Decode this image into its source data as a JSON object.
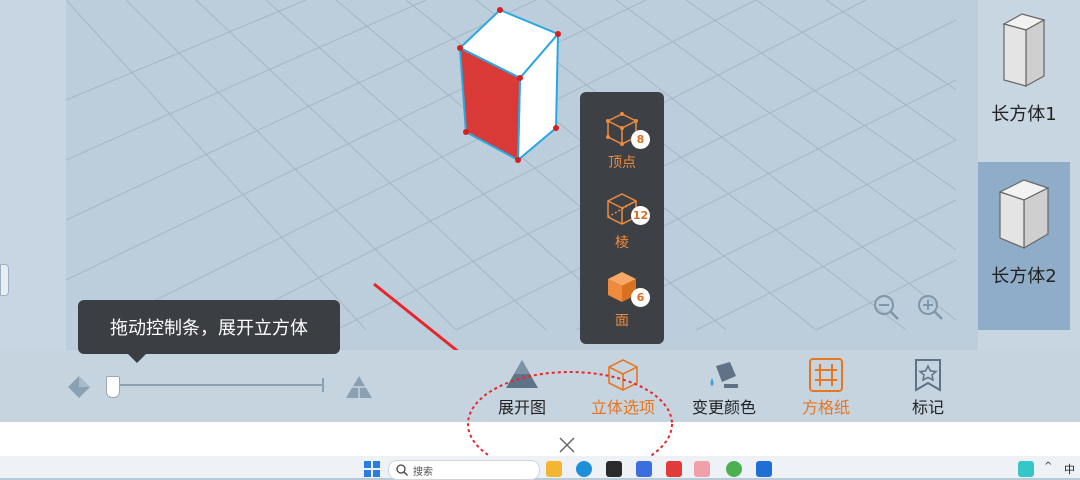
{
  "right_panel": {
    "items": [
      {
        "label": "长方体1",
        "active": false
      },
      {
        "label": "长方体2",
        "active": true
      }
    ]
  },
  "popup": {
    "items": [
      {
        "label": "顶点",
        "count": "8"
      },
      {
        "label": "棱",
        "count": "12"
      },
      {
        "label": "面",
        "count": "6"
      }
    ]
  },
  "tooltip": {
    "text": "拖动控制条，展开立方体"
  },
  "toolbar": {
    "tools": [
      {
        "label": "展开图"
      },
      {
        "label": "立体选项",
        "active": true
      },
      {
        "label": "变更颜色"
      },
      {
        "label": "方格纸"
      },
      {
        "label": "标记"
      }
    ]
  },
  "taskbar": {
    "search_placeholder": "搜索",
    "ime": "中",
    "tray_up": "^"
  },
  "colors": {
    "accent": "#e8761f",
    "cuboid_front": "#d93a38",
    "edge": "#29a8e0"
  }
}
